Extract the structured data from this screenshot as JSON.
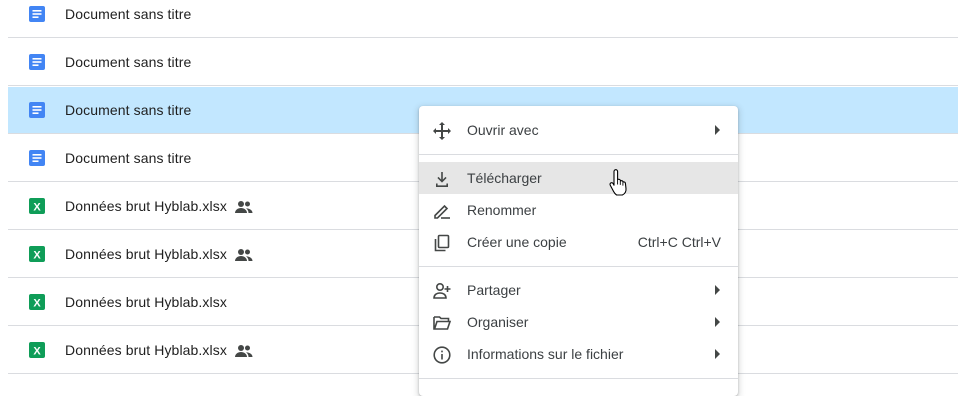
{
  "files": [
    {
      "name": "Document sans titre",
      "type": "doc",
      "shared": false,
      "selected": false
    },
    {
      "name": "Document sans titre",
      "type": "doc",
      "shared": false,
      "selected": false
    },
    {
      "name": "Document sans titre",
      "type": "doc",
      "shared": false,
      "selected": true
    },
    {
      "name": "Document sans titre",
      "type": "doc",
      "shared": false,
      "selected": false
    },
    {
      "name": "Données brut Hyblab.xlsx",
      "type": "xlsx",
      "shared": true,
      "selected": false
    },
    {
      "name": "Données brut Hyblab.xlsx",
      "type": "xlsx",
      "shared": true,
      "selected": false
    },
    {
      "name": "Données brut Hyblab.xlsx",
      "type": "xlsx",
      "shared": false,
      "selected": false
    },
    {
      "name": "Données brut Hyblab.xlsx",
      "type": "xlsx",
      "shared": true,
      "selected": false
    }
  ],
  "context_menu": {
    "open_with": "Ouvrir avec",
    "download": "Télécharger",
    "rename": "Renommer",
    "copy": "Créer une copie",
    "copy_shortcut": "Ctrl+C Ctrl+V",
    "share": "Partager",
    "organize": "Organiser",
    "file_info": "Informations sur le fichier"
  },
  "colors": {
    "doc_blue": "#4285f4",
    "sheets_green": "#0f9d58",
    "selected_row": "#c2e7ff",
    "hover_item": "#e6e6e6"
  }
}
